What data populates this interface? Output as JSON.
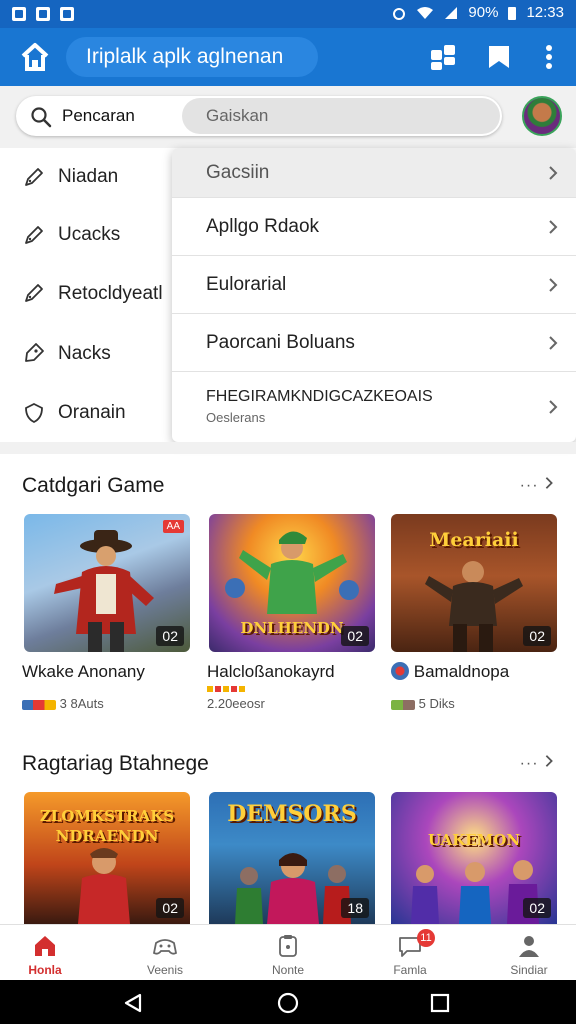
{
  "status_bar": {
    "battery": "90%",
    "time": "12:33"
  },
  "app_bar": {
    "title": "Iriplalk aplk aglnenan",
    "icons": [
      "home-icon",
      "puzzle-icon",
      "bookmark-icon",
      "more-vert-icon"
    ]
  },
  "search": {
    "label": "Pencaran",
    "placeholder": "Gaiskan"
  },
  "side_menu": {
    "items": [
      {
        "label": "Niadan",
        "icon": "pencil-icon"
      },
      {
        "label": "Ucacks",
        "icon": "pencil-icon"
      },
      {
        "label": "Retocldyeatl",
        "icon": "pencil-icon"
      },
      {
        "label": "Nacks",
        "icon": "tag-icon"
      },
      {
        "label": "Oranain",
        "icon": "shield-icon"
      }
    ]
  },
  "dropdown": {
    "items": [
      {
        "label": "Gacsiin"
      },
      {
        "label": "Apllgo Rdaok"
      },
      {
        "label": "Eulorarial"
      },
      {
        "label": "Paorcani Boluans"
      },
      {
        "label": "FHEGIRAMKNDIGCAZKEOAIS",
        "sub": "Oeslerans"
      }
    ]
  },
  "sections": [
    {
      "title": "Catdgari Game",
      "more": "···",
      "cards": [
        {
          "name": "Wkake Anonany",
          "meta": "3 8Auts",
          "badge": "02",
          "art": "",
          "tag": "AA"
        },
        {
          "name": "Halcloßanokayrd",
          "meta": "2.20eeosr",
          "badge": "02",
          "art": "DNLHENDN",
          "tag": ""
        },
        {
          "name": "Bamaldnopa",
          "meta": "5 Diks",
          "badge": "02",
          "art": "Meariaii",
          "tag": ""
        }
      ]
    },
    {
      "title": "Ragtariag Btahnege",
      "more": "···",
      "cards": [
        {
          "name": "",
          "meta": "",
          "badge": "02",
          "art": "ZLOMKSTRAKS NDRAENDN",
          "tag": ""
        },
        {
          "name": "",
          "meta": "",
          "badge": "18",
          "art": "DEMSORS",
          "tag": ""
        },
        {
          "name": "",
          "meta": "",
          "badge": "02",
          "art": "UAKEMON",
          "tag": ""
        }
      ]
    }
  ],
  "bottom_nav": {
    "items": [
      {
        "label": "Honla",
        "icon": "home-icon"
      },
      {
        "label": "Veenis",
        "icon": "controller-icon"
      },
      {
        "label": "Nonte",
        "icon": "gamepad-icon"
      },
      {
        "label": "Famla",
        "icon": "chat-icon",
        "badge": "11"
      },
      {
        "label": "Sindiar",
        "icon": "profile-icon"
      }
    ]
  },
  "colors": {
    "app_bar": "#1976d2",
    "status_bar": "#1565c0",
    "accent_red": "#d32f2f"
  }
}
